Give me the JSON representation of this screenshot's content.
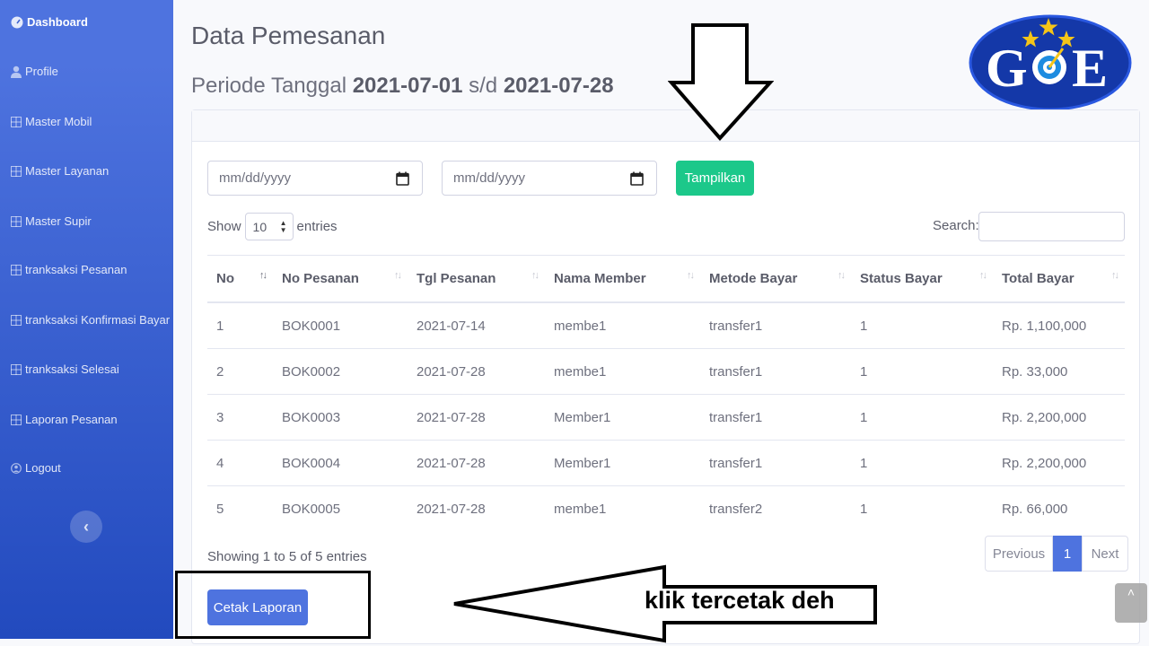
{
  "sidebar": {
    "items": [
      {
        "label": "Dashboard",
        "icon": "tachometer-icon"
      },
      {
        "label": "Profile",
        "icon": "user-icon"
      },
      {
        "label": "Master Mobil",
        "icon": "table-icon"
      },
      {
        "label": "Master Layanan",
        "icon": "table-icon"
      },
      {
        "label": "Master Supir",
        "icon": "table-icon"
      },
      {
        "label": "tranksaksi Pesanan",
        "icon": "table-icon"
      },
      {
        "label": "tranksaksi Konfirmasi Bayar",
        "icon": "table-icon"
      },
      {
        "label": "tranksaksi Selesai",
        "icon": "table-icon"
      },
      {
        "label": "Laporan Pesanan",
        "icon": "table-icon"
      },
      {
        "label": "Logout",
        "icon": "logout-icon"
      }
    ],
    "toggle": "‹"
  },
  "header": {
    "title": "Data Pemesanan",
    "period_label": "Periode Tanggal",
    "period_start": "2021-07-01",
    "period_sep": "s/d",
    "period_end": "2021-07-28"
  },
  "logo": {
    "text_left": "G",
    "text_right": "E",
    "colors": {
      "ellipse": "#1438a8",
      "star": "#f5c518"
    }
  },
  "filter": {
    "start_placeholder": "mm/dd/yyyy",
    "end_placeholder": "mm/dd/yyyy",
    "submit_label": "Tampilkan"
  },
  "table_controls": {
    "show_label": "Show",
    "entries_value": "10",
    "entries_label": "entries",
    "search_label": "Search:"
  },
  "table": {
    "columns": [
      "No",
      "No Pesanan",
      "Tgl Pesanan",
      "Nama Member",
      "Metode Bayar",
      "Status Bayar",
      "Total Bayar"
    ],
    "rows": [
      [
        "1",
        "BOK0001",
        "2021-07-14",
        "membe1",
        "transfer1",
        "1",
        "Rp. 1,100,000"
      ],
      [
        "2",
        "BOK0002",
        "2021-07-28",
        "membe1",
        "transfer1",
        "1",
        "Rp. 33,000"
      ],
      [
        "3",
        "BOK0003",
        "2021-07-28",
        "Member1",
        "transfer1",
        "1",
        "Rp. 2,200,000"
      ],
      [
        "4",
        "BOK0004",
        "2021-07-28",
        "Member1",
        "transfer1",
        "1",
        "Rp. 2,200,000"
      ],
      [
        "5",
        "BOK0005",
        "2021-07-28",
        "membe1",
        "transfer2",
        "1",
        "Rp. 66,000"
      ]
    ]
  },
  "footer": {
    "info": "Showing 1 to 5 of 5 entries",
    "prev": "Previous",
    "current_page": "1",
    "next": "Next",
    "print_label": "Cetak Laporan"
  },
  "annotation": {
    "label": "klik tercetak deh"
  },
  "colors": {
    "primary": "#4e73df",
    "success": "#1cc88a"
  }
}
